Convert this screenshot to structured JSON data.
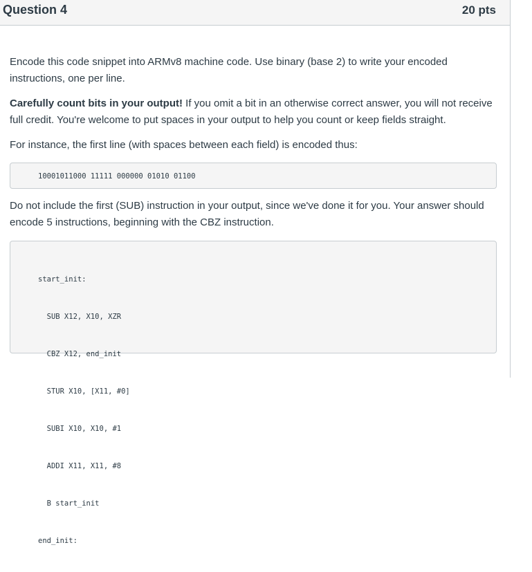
{
  "header": {
    "title": "Question 4",
    "points": "20 pts"
  },
  "body": {
    "p1": "Encode this code snippet into ARMv8 machine code. Use binary (base 2) to write your encoded instructions, one per line.",
    "p2_bold": "Carefully count bits in your output!",
    "p2_rest": " If you omit a bit in an otherwise correct answer, you will not receive full credit.  You're welcome to put spaces in your output to help you count or keep fields straight.",
    "p3": "For instance, the first line (with spaces between each field) is encoded thus:",
    "example_encoding": "10001011000 11111 000000 01010 01100",
    "p4": "Do not include the first (SUB) instruction in your output, since we've done it for you.  Your answer should encode 5 instructions, beginning with the CBZ instruction.",
    "code_lines": [
      "start_init:",
      "  SUB X12, X10, XZR",
      "  CBZ X12, end_init",
      "  STUR X10, [X11, #0]",
      "  SUBI X10, X10, #1",
      "  ADDI X11, X11, #8",
      "  B start_init",
      "end_init:"
    ]
  }
}
